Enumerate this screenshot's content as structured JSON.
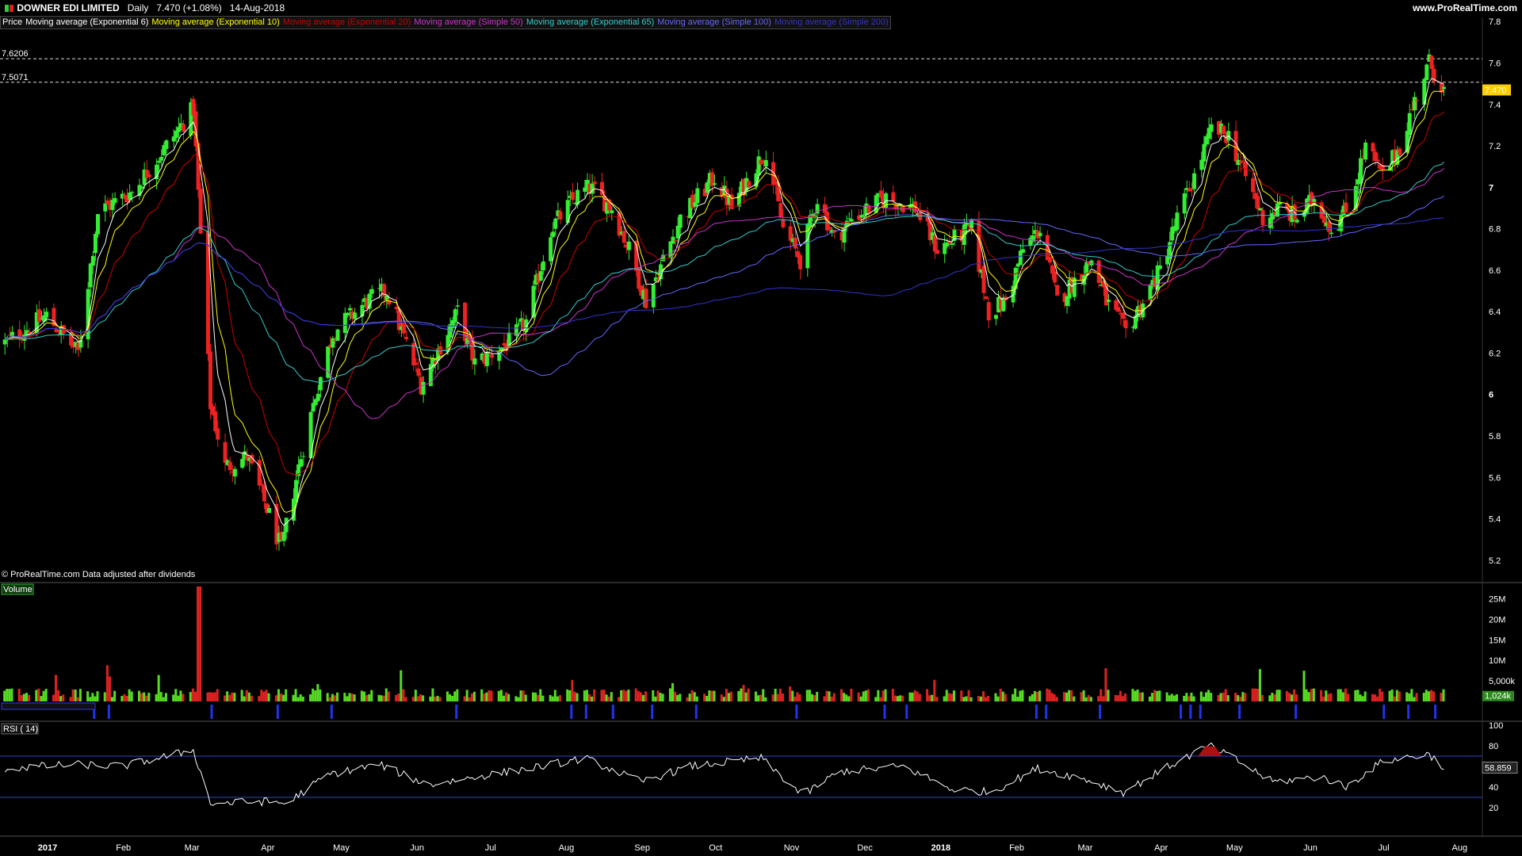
{
  "header": {
    "instrument": "DOWNER EDI LIMITED",
    "period": "Daily",
    "price_change": "7.470 (+1.08%)",
    "date": "14-Aug-2018",
    "site": "www.ProRealTime.com"
  },
  "legend": {
    "price_label": "Price",
    "items": [
      {
        "label": "Moving average (Exponential 6)",
        "color": "#ffffff"
      },
      {
        "label": "Moving average (Exponential 10)",
        "color": "#ffff00"
      },
      {
        "label": "Moving average (Exponential 20)",
        "color": "#cc0000"
      },
      {
        "label": "Moving average (Simple 50)",
        "color": "#cc33cc"
      },
      {
        "label": "Moving average (Exponential 65)",
        "color": "#33cccc"
      },
      {
        "label": "Moving average (Simple 100)",
        "color": "#6666ff"
      },
      {
        "label": "Moving average (Simple 200)",
        "color": "#3333cc"
      }
    ]
  },
  "footer_note": "© ProRealTime.com  Data adjusted after dividends",
  "chart_data": [
    {
      "type": "candlestick",
      "price_axis": {
        "ticks": [
          "7.8",
          "7.6",
          "7.4",
          "7.2",
          "7",
          "6.8",
          "6.6",
          "6.4",
          "6.2",
          "6",
          "5.8",
          "5.6",
          "5.4",
          "5.2"
        ],
        "ylim": [
          5.1,
          7.82
        ]
      },
      "reference_lines": [
        {
          "label": "7.6206",
          "value": 7.6206
        },
        {
          "label": "7.5071",
          "value": 7.5071
        }
      ],
      "last_price": "7.470",
      "x_ticks": [
        "2017",
        "Feb",
        "Mar",
        "Apr",
        "May",
        "Jun",
        "Jul",
        "Aug",
        "Sep",
        "Oct",
        "Nov",
        "Dec",
        "2018",
        "Feb",
        "Mar",
        "Apr",
        "May",
        "Jun",
        "Jul",
        "Aug"
      ],
      "close_path": [
        {
          "date": "2017-01-03",
          "value": 6.25
        },
        {
          "date": "2017-01-20",
          "value": 6.38
        },
        {
          "date": "2017-02-02",
          "value": 6.2
        },
        {
          "date": "2017-02-10",
          "value": 6.88
        },
        {
          "date": "2017-02-24",
          "value": 6.98
        },
        {
          "date": "2017-03-10",
          "value": 7.2
        },
        {
          "date": "2017-03-21",
          "value": 7.38
        },
        {
          "date": "2017-03-28",
          "value": 5.95
        },
        {
          "date": "2017-04-03",
          "value": 5.65
        },
        {
          "date": "2017-04-12",
          "value": 5.7
        },
        {
          "date": "2017-04-20",
          "value": 5.45
        },
        {
          "date": "2017-04-26",
          "value": 5.25
        },
        {
          "date": "2017-05-03",
          "value": 5.65
        },
        {
          "date": "2017-05-10",
          "value": 6.0
        },
        {
          "date": "2017-05-17",
          "value": 6.3
        },
        {
          "date": "2017-05-31",
          "value": 6.45
        },
        {
          "date": "2017-06-08",
          "value": 6.5
        },
        {
          "date": "2017-06-22",
          "value": 6.05
        },
        {
          "date": "2017-07-07",
          "value": 6.4
        },
        {
          "date": "2017-07-14",
          "value": 6.15
        },
        {
          "date": "2017-07-28",
          "value": 6.25
        },
        {
          "date": "2017-08-04",
          "value": 6.35
        },
        {
          "date": "2017-08-14",
          "value": 6.8
        },
        {
          "date": "2017-08-24",
          "value": 6.95
        },
        {
          "date": "2017-08-30",
          "value": 7.0
        },
        {
          "date": "2017-09-08",
          "value": 6.9
        },
        {
          "date": "2017-09-15",
          "value": 6.7
        },
        {
          "date": "2017-09-22",
          "value": 6.45
        },
        {
          "date": "2017-09-29",
          "value": 6.65
        },
        {
          "date": "2017-10-06",
          "value": 6.85
        },
        {
          "date": "2017-10-20",
          "value": 7.05
        },
        {
          "date": "2017-10-27",
          "value": 6.9
        },
        {
          "date": "2017-11-03",
          "value": 7.05
        },
        {
          "date": "2017-11-10",
          "value": 7.18
        },
        {
          "date": "2017-11-17",
          "value": 6.8
        },
        {
          "date": "2017-11-24",
          "value": 6.65
        },
        {
          "date": "2017-12-01",
          "value": 6.95
        },
        {
          "date": "2017-12-08",
          "value": 6.75
        },
        {
          "date": "2017-12-15",
          "value": 6.85
        },
        {
          "date": "2017-12-29",
          "value": 6.95
        },
        {
          "date": "2018-01-10",
          "value": 6.9
        },
        {
          "date": "2018-01-19",
          "value": 6.7
        },
        {
          "date": "2018-01-26",
          "value": 6.75
        },
        {
          "date": "2018-02-02",
          "value": 6.8
        },
        {
          "date": "2018-02-09",
          "value": 6.4
        },
        {
          "date": "2018-02-16",
          "value": 6.45
        },
        {
          "date": "2018-02-23",
          "value": 6.7
        },
        {
          "date": "2018-03-02",
          "value": 6.8
        },
        {
          "date": "2018-03-09",
          "value": 6.45
        },
        {
          "date": "2018-03-16",
          "value": 6.55
        },
        {
          "date": "2018-03-23",
          "value": 6.65
        },
        {
          "date": "2018-03-29",
          "value": 6.45
        },
        {
          "date": "2018-04-06",
          "value": 6.3
        },
        {
          "date": "2018-04-13",
          "value": 6.45
        },
        {
          "date": "2018-04-20",
          "value": 6.6
        },
        {
          "date": "2018-04-27",
          "value": 6.85
        },
        {
          "date": "2018-05-04",
          "value": 7.05
        },
        {
          "date": "2018-05-11",
          "value": 7.28
        },
        {
          "date": "2018-05-18",
          "value": 7.25
        },
        {
          "date": "2018-05-25",
          "value": 7.05
        },
        {
          "date": "2018-06-01",
          "value": 6.85
        },
        {
          "date": "2018-06-08",
          "value": 6.9
        },
        {
          "date": "2018-06-15",
          "value": 6.85
        },
        {
          "date": "2018-06-22",
          "value": 6.95
        },
        {
          "date": "2018-06-29",
          "value": 6.8
        },
        {
          "date": "2018-07-06",
          "value": 6.9
        },
        {
          "date": "2018-07-13",
          "value": 7.2
        },
        {
          "date": "2018-07-20",
          "value": 7.05
        },
        {
          "date": "2018-07-27",
          "value": 7.2
        },
        {
          "date": "2018-08-03",
          "value": 7.45
        },
        {
          "date": "2018-08-08",
          "value": 7.6
        },
        {
          "date": "2018-08-14",
          "value": 7.47
        }
      ]
    },
    {
      "type": "bar",
      "title": "Volume",
      "volume_axis": {
        "ticks": [
          "25M",
          "20M",
          "15M",
          "10M",
          "5,000k"
        ],
        "ylim": [
          0,
          28
        ]
      },
      "last_value": "1,024k",
      "spike": {
        "date": "2017-03-24",
        "value": 28
      }
    },
    {
      "type": "line",
      "title": "RSI ( 14)",
      "rsi_axis": {
        "ticks": [
          "100",
          "80",
          "40",
          "20"
        ],
        "ylim": [
          0,
          100
        ]
      },
      "overbought": 70,
      "oversold": 30,
      "last_value": "58.859",
      "values": [
        {
          "date": "2017-01-03",
          "value": 58
        },
        {
          "date": "2017-02-01",
          "value": 62
        },
        {
          "date": "2017-02-20",
          "value": 60
        },
        {
          "date": "2017-03-21",
          "value": 76
        },
        {
          "date": "2017-03-28",
          "value": 24
        },
        {
          "date": "2017-04-20",
          "value": 26
        },
        {
          "date": "2017-04-28",
          "value": 24
        },
        {
          "date": "2017-05-15",
          "value": 52
        },
        {
          "date": "2017-06-05",
          "value": 62
        },
        {
          "date": "2017-06-25",
          "value": 42
        },
        {
          "date": "2017-07-15",
          "value": 50
        },
        {
          "date": "2017-08-10",
          "value": 60
        },
        {
          "date": "2017-08-28",
          "value": 68
        },
        {
          "date": "2017-09-20",
          "value": 45
        },
        {
          "date": "2017-10-10",
          "value": 60
        },
        {
          "date": "2017-11-08",
          "value": 68
        },
        {
          "date": "2017-11-25",
          "value": 32
        },
        {
          "date": "2017-12-10",
          "value": 55
        },
        {
          "date": "2018-01-05",
          "value": 60
        },
        {
          "date": "2018-01-25",
          "value": 38
        },
        {
          "date": "2018-02-10",
          "value": 35
        },
        {
          "date": "2018-03-01",
          "value": 58
        },
        {
          "date": "2018-03-20",
          "value": 48
        },
        {
          "date": "2018-04-05",
          "value": 35
        },
        {
          "date": "2018-04-25",
          "value": 62
        },
        {
          "date": "2018-05-10",
          "value": 80
        },
        {
          "date": "2018-05-20",
          "value": 68
        },
        {
          "date": "2018-06-05",
          "value": 45
        },
        {
          "date": "2018-06-25",
          "value": 50
        },
        {
          "date": "2018-07-05",
          "value": 40
        },
        {
          "date": "2018-07-20",
          "value": 65
        },
        {
          "date": "2018-08-08",
          "value": 72
        },
        {
          "date": "2018-08-14",
          "value": 58.859
        }
      ]
    }
  ]
}
